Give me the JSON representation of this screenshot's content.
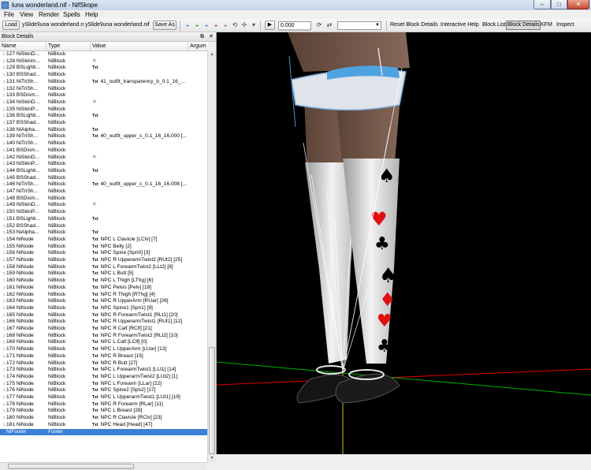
{
  "window": {
    "title": "luna wonderland.nif - NifSkope",
    "minimize": "–",
    "maximize": "□",
    "close": "✕"
  },
  "menu": [
    "File",
    "View",
    "Render",
    "Spells",
    "Help"
  ],
  "toolbar": {
    "load_label": "Load",
    "load_path": "ySlide\\luna wonderland.nif",
    "save_path": "ySlide\\luna wonderland.nif",
    "save_as_label": "Save As",
    "time_value": "0.000",
    "animation_value": "",
    "reset_block_details": "Reset Block Details",
    "interactive_help": "Interactive Help",
    "block_list": "Block List",
    "block_details": "Block Details",
    "kfm": "KFM",
    "inspect": "Inspect"
  },
  "dock": {
    "title": "Block Details",
    "float_icon": "⧉",
    "close_icon": "✕",
    "columns": [
      "Name",
      "Type",
      "Value",
      "Argum"
    ]
  },
  "rows": [
    {
      "name": "127 NiSkinD...",
      "type": "NiBlock",
      "value": ""
    },
    {
      "name": "128 NiSkinIn...",
      "type": "NiBlock",
      "value": "",
      "star": true
    },
    {
      "name": "129 BSLighti...",
      "type": "NiBlock",
      "value": "",
      "txt": true
    },
    {
      "name": "130 BSShad...",
      "type": "NiBlock",
      "value": ""
    },
    {
      "name": "131 NiTriSh...",
      "type": "NiBlock",
      "value": "41_outfit_transparency_b_0.1_16_...",
      "txt": true
    },
    {
      "name": "132 NiTriSh...",
      "type": "NiBlock",
      "value": ""
    },
    {
      "name": "133 BSDism...",
      "type": "NiBlock",
      "value": ""
    },
    {
      "name": "134 NiSkinD...",
      "type": "NiBlock",
      "value": "",
      "star": true
    },
    {
      "name": "135 NiSkinP...",
      "type": "NiBlock",
      "value": ""
    },
    {
      "name": "136 BSLighti...",
      "type": "NiBlock",
      "value": "",
      "txt": true
    },
    {
      "name": "137 BSShad...",
      "type": "NiBlock",
      "value": ""
    },
    {
      "name": "138 NiAlpha...",
      "type": "NiBlock",
      "value": "",
      "txt": true
    },
    {
      "name": "139 NiTriSh...",
      "type": "NiBlock",
      "value": "40_outfit_upper_c_0.1_16_16.000 [...",
      "txt": true
    },
    {
      "name": "140 NiTriSh...",
      "type": "NiBlock",
      "value": ""
    },
    {
      "name": "141 BSDism...",
      "type": "NiBlock",
      "value": ""
    },
    {
      "name": "142 NiSkinD...",
      "type": "NiBlock",
      "value": "",
      "star": true
    },
    {
      "name": "143 NiSkinP...",
      "type": "NiBlock",
      "value": ""
    },
    {
      "name": "144 BSLighti...",
      "type": "NiBlock",
      "value": "",
      "txt": true
    },
    {
      "name": "145 BSShad...",
      "type": "NiBlock",
      "value": ""
    },
    {
      "name": "146 NiTriSh...",
      "type": "NiBlock",
      "value": "40_outfit_upper_c_0.1_16_16.008 [...",
      "txt": true
    },
    {
      "name": "147 NiTriSh...",
      "type": "NiBlock",
      "value": ""
    },
    {
      "name": "148 BSDism...",
      "type": "NiBlock",
      "value": ""
    },
    {
      "name": "149 NiSkinD...",
      "type": "NiBlock",
      "value": "",
      "star": true
    },
    {
      "name": "150 NiSkinP...",
      "type": "NiBlock",
      "value": ""
    },
    {
      "name": "151 BSLighti...",
      "type": "NiBlock",
      "value": "",
      "txt": true
    },
    {
      "name": "152 BSShad...",
      "type": "NiBlock",
      "value": ""
    },
    {
      "name": "153 NiAlpha...",
      "type": "NiBlock",
      "value": "",
      "txt": true
    },
    {
      "name": "154 NiNode",
      "type": "NiBlock",
      "value": "NPC L Clavicle [LClv] [7]",
      "txt": true
    },
    {
      "name": "155 NiNode",
      "type": "NiBlock",
      "value": "NPC Belly [2]",
      "txt": true
    },
    {
      "name": "156 NiNode",
      "type": "NiBlock",
      "value": "NPC Spine [Spn0] [3]",
      "txt": true
    },
    {
      "name": "157 NiNode",
      "type": "NiBlock",
      "value": "NPC R UpperarmTwist2 [RUt2] [25]",
      "txt": true
    },
    {
      "name": "158 NiNode",
      "type": "NiBlock",
      "value": "NPC L ForearmTwist2 [LLt2] [8]",
      "txt": true
    },
    {
      "name": "159 NiNode",
      "type": "NiBlock",
      "value": "NPC L Butt [5]",
      "txt": true
    },
    {
      "name": "160 NiNode",
      "type": "NiBlock",
      "value": "NPC L Thigh [LThg] [6]",
      "txt": true
    },
    {
      "name": "161 NiNode",
      "type": "NiBlock",
      "value": "NPC Pelvis [Pelv] [18]",
      "txt": true
    },
    {
      "name": "162 NiNode",
      "type": "NiBlock",
      "value": "NPC R Thigh [RThg] [4]",
      "txt": true
    },
    {
      "name": "163 NiNode",
      "type": "NiBlock",
      "value": "NPC R UpperArm [RUar] [26]",
      "txt": true
    },
    {
      "name": "164 NiNode",
      "type": "NiBlock",
      "value": "NPC Spine1 [Spn1] [9]",
      "txt": true
    },
    {
      "name": "165 NiNode",
      "type": "NiBlock",
      "value": "NPC R ForearmTwist1 [RLt1] [20]",
      "txt": true
    },
    {
      "name": "166 NiNode",
      "type": "NiBlock",
      "value": "NPC R UpperarmTwist1 [RUt1] [12]",
      "txt": true
    },
    {
      "name": "167 NiNode",
      "type": "NiBlock",
      "value": "NPC R Calf [RClf] [21]",
      "txt": true
    },
    {
      "name": "168 NiNode",
      "type": "NiBlock",
      "value": "NPC R ForearmTwist2 [RLt2] [10]",
      "txt": true
    },
    {
      "name": "169 NiNode",
      "type": "NiBlock",
      "value": "NPC L Calf [LClf] [0]",
      "txt": true
    },
    {
      "name": "170 NiNode",
      "type": "NiBlock",
      "value": "NPC L UpperArm [LUar] [13]",
      "txt": true
    },
    {
      "name": "171 NiNode",
      "type": "NiBlock",
      "value": "NPC R Breast [15]",
      "txt": true
    },
    {
      "name": "172 NiNode",
      "type": "NiBlock",
      "value": "NPC R Butt [27]",
      "txt": true
    },
    {
      "name": "173 NiNode",
      "type": "NiBlock",
      "value": "NPC L ForearmTwist1 [LLt1] [14]",
      "txt": true
    },
    {
      "name": "174 NiNode",
      "type": "NiBlock",
      "value": "NPC L UpperarmTwist2 [LUt2] [1]",
      "txt": true
    },
    {
      "name": "175 NiNode",
      "type": "NiBlock",
      "value": "NPC L Forearm [LLar] [22]",
      "txt": true
    },
    {
      "name": "176 NiNode",
      "type": "NiBlock",
      "value": "NPC Spine2 [Spn2] [17]",
      "txt": true
    },
    {
      "name": "177 NiNode",
      "type": "NiBlock",
      "value": "NPC L UpperarmTwist1 [LUt1] [19]",
      "txt": true
    },
    {
      "name": "178 NiNode",
      "type": "NiBlock",
      "value": "NPC R Forearm [RLar] [11]",
      "txt": true
    },
    {
      "name": "179 NiNode",
      "type": "NiBlock",
      "value": "NPC L Breast [28]",
      "txt": true
    },
    {
      "name": "180 NiNode",
      "type": "NiBlock",
      "value": "NPC R Clavicle [RClv] [23]",
      "txt": true
    },
    {
      "name": "181 NiNode",
      "type": "NiBlock",
      "value": "NPC Head [Head] [47]",
      "txt": true
    },
    {
      "name": "NiFooter",
      "type": "Footer",
      "value": "",
      "selected": true,
      "noarrow": true
    }
  ],
  "txt_tag": "Txt",
  "star_glyph": "✳",
  "colors": {
    "selection": "#3a80d8",
    "viewport_bg": "#000000",
    "axis_red": "#ff0000",
    "axis_green": "#00c000"
  }
}
